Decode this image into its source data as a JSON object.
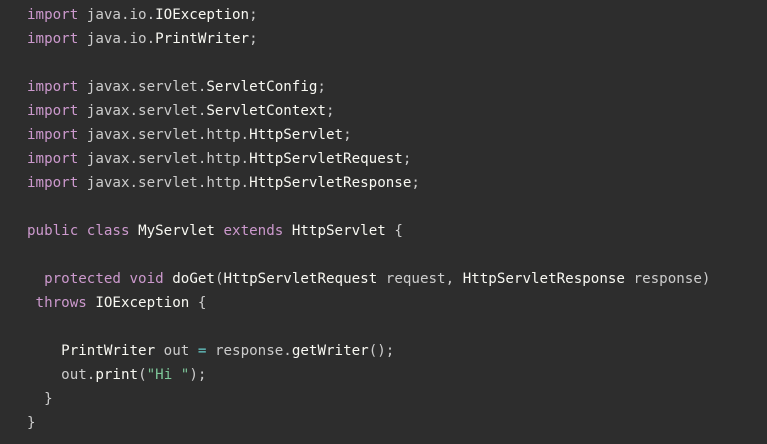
{
  "colors": {
    "background": "#2d2d2d",
    "keyword": "#cc99cd",
    "class_name": "#f8f8f2",
    "plain": "#cccccc",
    "string": "#7ec699",
    "operator": "#67cdcc"
  },
  "code": {
    "lines": [
      [
        {
          "t": "import",
          "k": "kw"
        },
        {
          "t": " java.io.",
          "k": "pkg"
        },
        {
          "t": "IOException",
          "k": "cls"
        },
        {
          "t": ";",
          "k": "punc"
        }
      ],
      [
        {
          "t": "import",
          "k": "kw"
        },
        {
          "t": " java.io.",
          "k": "pkg"
        },
        {
          "t": "PrintWriter",
          "k": "cls"
        },
        {
          "t": ";",
          "k": "punc"
        }
      ],
      [],
      [
        {
          "t": "import",
          "k": "kw"
        },
        {
          "t": " javax.servlet.",
          "k": "pkg"
        },
        {
          "t": "ServletConfig",
          "k": "cls"
        },
        {
          "t": ";",
          "k": "punc"
        }
      ],
      [
        {
          "t": "import",
          "k": "kw"
        },
        {
          "t": " javax.servlet.",
          "k": "pkg"
        },
        {
          "t": "ServletContext",
          "k": "cls"
        },
        {
          "t": ";",
          "k": "punc"
        }
      ],
      [
        {
          "t": "import",
          "k": "kw"
        },
        {
          "t": " javax.servlet.http.",
          "k": "pkg"
        },
        {
          "t": "HttpServlet",
          "k": "cls"
        },
        {
          "t": ";",
          "k": "punc"
        }
      ],
      [
        {
          "t": "import",
          "k": "kw"
        },
        {
          "t": " javax.servlet.http.",
          "k": "pkg"
        },
        {
          "t": "HttpServletRequest",
          "k": "cls"
        },
        {
          "t": ";",
          "k": "punc"
        }
      ],
      [
        {
          "t": "import",
          "k": "kw"
        },
        {
          "t": " javax.servlet.http.",
          "k": "pkg"
        },
        {
          "t": "HttpServletResponse",
          "k": "cls"
        },
        {
          "t": ";",
          "k": "punc"
        }
      ],
      [],
      [
        {
          "t": "public",
          "k": "kw"
        },
        {
          "t": " ",
          "k": "plain"
        },
        {
          "t": "class",
          "k": "kw"
        },
        {
          "t": " ",
          "k": "plain"
        },
        {
          "t": "MyServlet",
          "k": "cls"
        },
        {
          "t": " ",
          "k": "plain"
        },
        {
          "t": "extends",
          "k": "kw"
        },
        {
          "t": " ",
          "k": "plain"
        },
        {
          "t": "HttpServlet",
          "k": "cls"
        },
        {
          "t": " {",
          "k": "punc"
        }
      ],
      [],
      [
        {
          "t": "  ",
          "k": "plain"
        },
        {
          "t": "protected",
          "k": "kw"
        },
        {
          "t": " ",
          "k": "plain"
        },
        {
          "t": "void",
          "k": "kw"
        },
        {
          "t": " ",
          "k": "plain"
        },
        {
          "t": "doGet",
          "k": "fn"
        },
        {
          "t": "(",
          "k": "punc"
        },
        {
          "t": "HttpServletRequest",
          "k": "cls"
        },
        {
          "t": " request",
          "k": "plain"
        },
        {
          "t": ",",
          "k": "punc"
        },
        {
          "t": " ",
          "k": "plain"
        },
        {
          "t": "HttpServletResponse",
          "k": "cls"
        },
        {
          "t": " response",
          "k": "plain"
        },
        {
          "t": ")",
          "k": "punc"
        }
      ],
      [
        {
          "t": " ",
          "k": "plain"
        },
        {
          "t": "throws",
          "k": "kw"
        },
        {
          "t": " ",
          "k": "plain"
        },
        {
          "t": "IOException",
          "k": "cls"
        },
        {
          "t": " {",
          "k": "punc"
        }
      ],
      [],
      [
        {
          "t": "    ",
          "k": "plain"
        },
        {
          "t": "PrintWriter",
          "k": "cls"
        },
        {
          "t": " out ",
          "k": "plain"
        },
        {
          "t": "=",
          "k": "op"
        },
        {
          "t": " response",
          "k": "plain"
        },
        {
          "t": ".",
          "k": "punc"
        },
        {
          "t": "getWriter",
          "k": "fn"
        },
        {
          "t": "();",
          "k": "punc"
        }
      ],
      [
        {
          "t": "    out",
          "k": "plain"
        },
        {
          "t": ".",
          "k": "punc"
        },
        {
          "t": "print",
          "k": "fn"
        },
        {
          "t": "(",
          "k": "punc"
        },
        {
          "t": "\"Hi \"",
          "k": "str"
        },
        {
          "t": ");",
          "k": "punc"
        }
      ],
      [
        {
          "t": "  }",
          "k": "punc"
        }
      ],
      [
        {
          "t": "}",
          "k": "punc"
        }
      ]
    ]
  }
}
